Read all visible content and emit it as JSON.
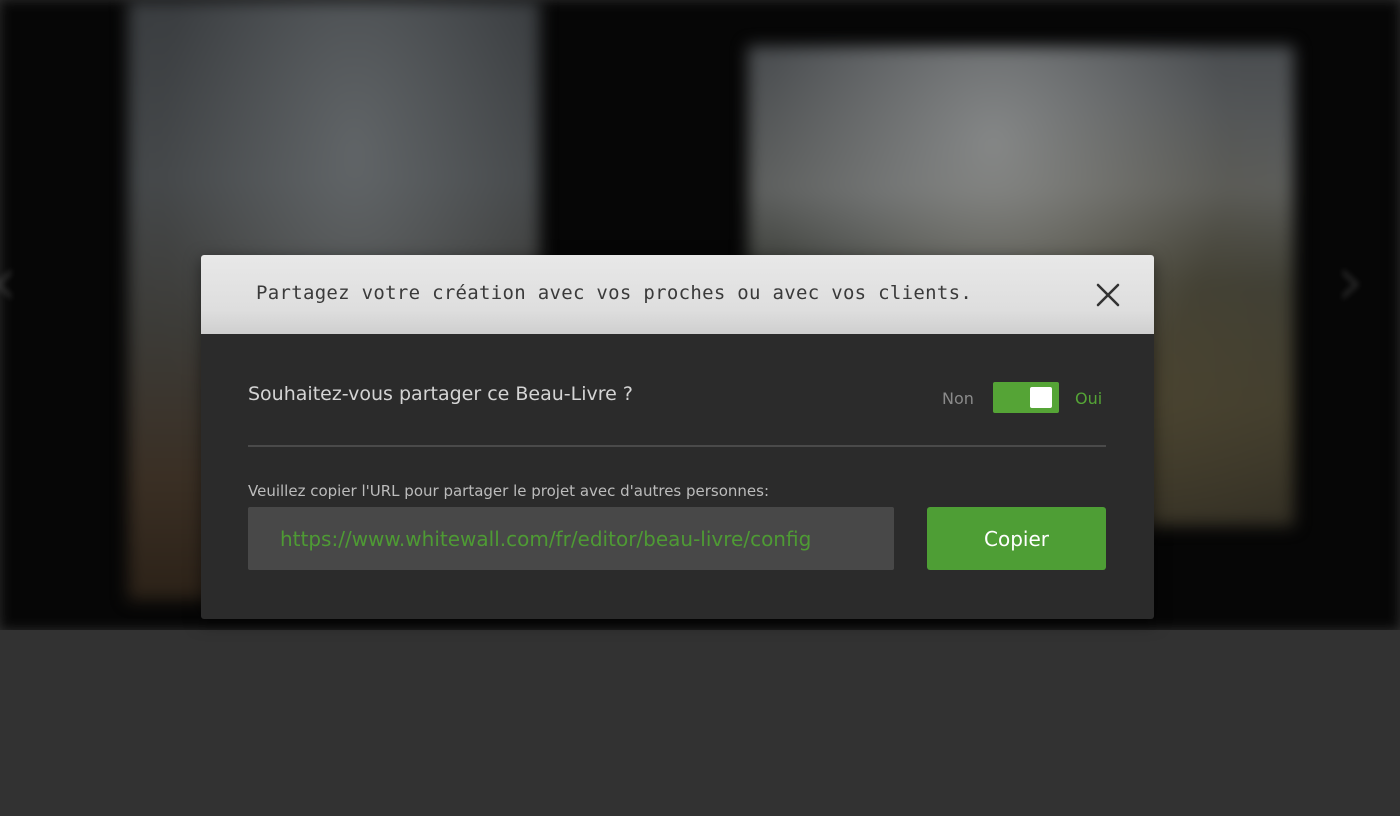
{
  "modal": {
    "title": "Partagez votre création avec vos proches ou avec vos clients.",
    "close_icon": "close-icon",
    "question": "Souhaitez-vous partager ce Beau-Livre ?",
    "toggle": {
      "off_label": "Non",
      "on_label": "Oui",
      "state": "on"
    },
    "instruction": "Veuillez copier l'URL pour partager le projet avec d'autres personnes:",
    "url_value": "https://www.whitewall.com/fr/editor/beau-livre/config",
    "copy_label": "Copier"
  },
  "colors": {
    "accent_green": "#55a436",
    "header_bg": "#dedede",
    "modal_bg": "#2b2b2b"
  }
}
